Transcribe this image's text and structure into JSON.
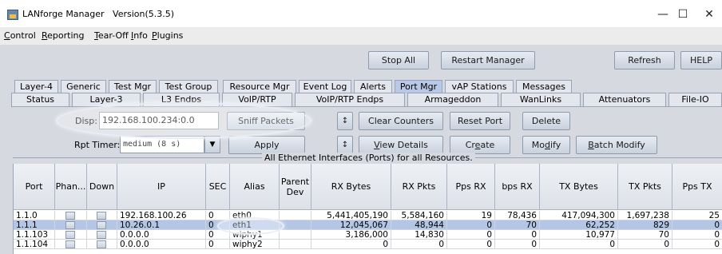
{
  "window": {
    "app_name": "LANforge Manager",
    "version": "Version(5.3.5)",
    "minimize": "—",
    "maximize": "☐",
    "close": "✕"
  },
  "menu": [
    {
      "mn": "C",
      "rest": "ontrol"
    },
    {
      "mn": "R",
      "rest": "eporting"
    },
    {
      "mn": "T",
      "rest": "ear-Off"
    },
    {
      "mn": "I",
      "rest": "nfo"
    },
    {
      "mn": "P",
      "rest": "lugins"
    }
  ],
  "toolbar": {
    "stop_all": "Stop All",
    "restart_manager": "Restart Manager",
    "refresh": "Refresh",
    "help": "HELP"
  },
  "tabs_row1": [
    "Layer-4",
    "Generic",
    "Test Mgr",
    "Test Group",
    "Resource Mgr",
    "Event Log",
    "Alerts",
    "Port Mgr",
    "vAP Stations",
    "Messages"
  ],
  "tabs_row1_active": "Port Mgr",
  "tabs_row2": [
    "Status",
    "Layer-3",
    "L3 Endps",
    "VoIP/RTP",
    "VoIP/RTP Endps",
    "Armageddon",
    "WanLinks",
    "Attenuators",
    "File-IO"
  ],
  "controls": {
    "disp_label": "Disp:",
    "disp_value": "192.168.100.234:0.0",
    "sniff_packets": "Sniff Packets",
    "rpt_timer_label": "Rpt Timer:",
    "rpt_timer_value": "medium  (8 s)",
    "apply": "Apply",
    "up_arrow": "↕",
    "down_arrow": "↕",
    "clear_counters": "Clear Counters",
    "reset_port": "Reset Port",
    "delete": "Delete",
    "view_details_mn": "V",
    "view_details_rest": "iew Details",
    "create_pre": "Cr",
    "create_mn": "e",
    "create_post": "ate",
    "modify_pre": "Mo",
    "modify_mn": "d",
    "modify_post": "ify",
    "batch_modify_mn": "B",
    "batch_modify_rest": "atch Modify"
  },
  "table": {
    "title": "All Ethernet Interfaces (Ports) for all Resources.",
    "headers": [
      "Port",
      "Phan...",
      "Down",
      "IP",
      "SEC",
      "Alias",
      "Parent Dev",
      "RX Bytes",
      "RX Pkts",
      "Pps RX",
      "bps RX",
      "TX Bytes",
      "TX Pkts",
      "Pps TX"
    ],
    "rows": [
      [
        "1.1.0",
        "",
        "",
        "192.168.100.26",
        "0",
        "eth0",
        "",
        "5,441,405,190",
        "5,584,160",
        "19",
        "78,436",
        "417,094,300",
        "1,697,238",
        "25"
      ],
      [
        "1.1.1",
        "",
        "",
        "10.26.0.1",
        "0",
        "eth1",
        "",
        "12,045,067",
        "48,944",
        "0",
        "70",
        "62,252",
        "829",
        "0"
      ],
      [
        "1.1.103",
        "",
        "",
        "0.0.0.0",
        "0",
        "wiphy1",
        "",
        "3,186,000",
        "14,830",
        "0",
        "0",
        "10,977",
        "70",
        "0"
      ],
      [
        "1.1.104",
        "",
        "",
        "0.0.0.0",
        "0",
        "wiphy2",
        "",
        "0",
        "0",
        "0",
        "0",
        "0",
        "0",
        "0"
      ]
    ],
    "selected_row": 1
  }
}
